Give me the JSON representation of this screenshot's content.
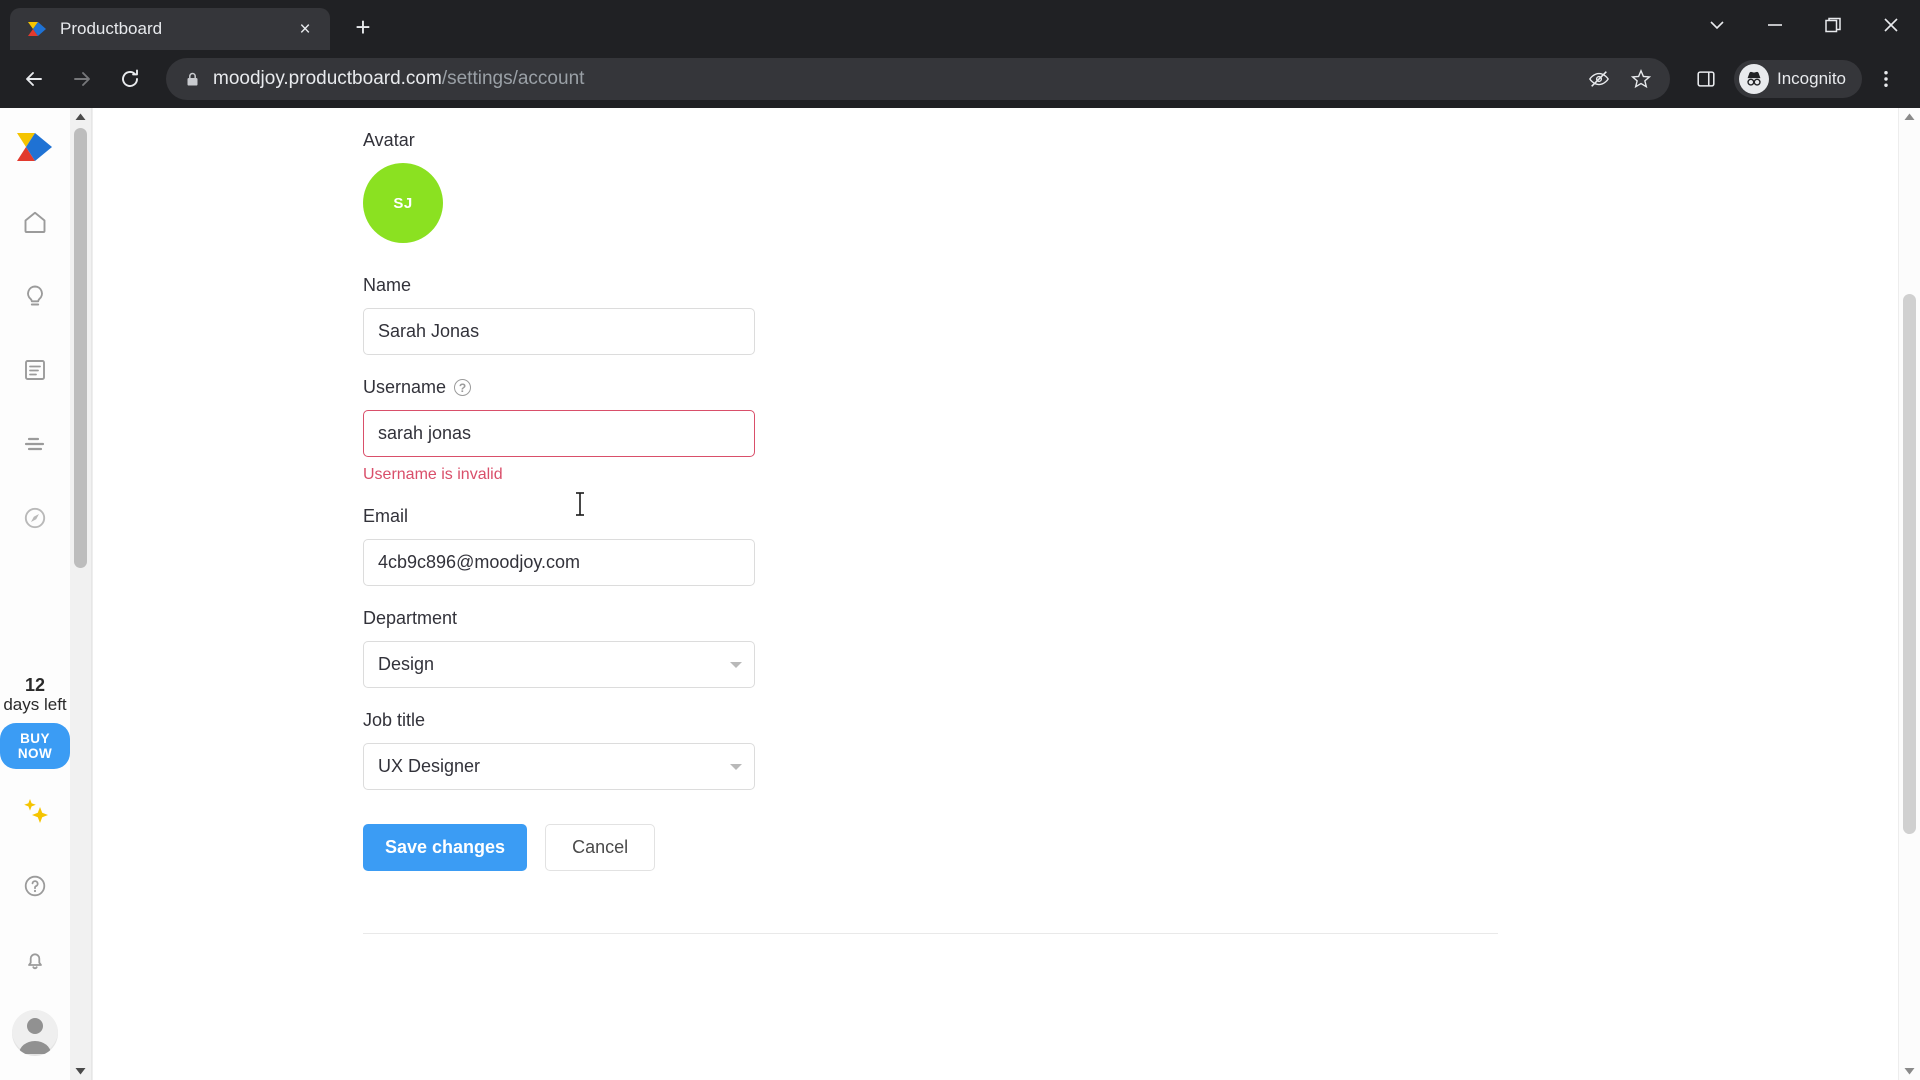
{
  "browser": {
    "tab": {
      "title": "Productboard",
      "favicon": "productboard-logo-icon",
      "close_label": "×"
    },
    "new_tab_label": "+",
    "window_controls": {
      "minimize": "−",
      "restore": "❐",
      "close": "✕",
      "tab_search": "∨"
    },
    "nav": {
      "back": "←",
      "forward": "→",
      "reload": "↻"
    },
    "address": {
      "lock_icon": "lock-icon",
      "host": "moodjoy.productboard.com",
      "path": "/settings/account",
      "full_url": "moodjoy.productboard.com/settings/account"
    },
    "omnibox_icons": {
      "tracking_protection": "eye-off-icon",
      "bookmark": "star-icon"
    },
    "toolbar_icons": {
      "side_panel": "side-panel-icon",
      "menu": "three-dot-menu-icon"
    },
    "profile": {
      "label": "Incognito",
      "icon": "incognito-hat-icon"
    }
  },
  "rail": {
    "logo": "productboard-logo-icon",
    "items": [
      {
        "name": "home",
        "icon": "home-icon"
      },
      {
        "name": "insights",
        "icon": "lightbulb-icon"
      },
      {
        "name": "features",
        "icon": "document-icon"
      },
      {
        "name": "roadmap",
        "icon": "list-lines-icon"
      },
      {
        "name": "portal",
        "icon": "compass-icon"
      }
    ],
    "trial": {
      "days": "12",
      "label": "days left",
      "cta": "BUY NOW"
    },
    "sparkle_icon": "sparkles-icon",
    "bottom_items": [
      {
        "name": "help",
        "icon": "question-circle-icon"
      },
      {
        "name": "notifications",
        "icon": "bell-icon"
      },
      {
        "name": "account",
        "icon": "user-avatar-icon"
      }
    ]
  },
  "form": {
    "avatar": {
      "label": "Avatar",
      "initials": "SJ",
      "color": "#8be121"
    },
    "name": {
      "label": "Name",
      "value": "Sarah Jonas"
    },
    "username": {
      "label": "Username",
      "help_icon": "question-circle-icon",
      "value": "sarah jonas",
      "error": "Username is invalid",
      "error_color": "#d94f6a",
      "invalid": true
    },
    "email": {
      "label": "Email",
      "value": "4cb9c896@moodjoy.com"
    },
    "department": {
      "label": "Department",
      "value": "Design"
    },
    "job_title": {
      "label": "Job title",
      "value": "UX Designer"
    },
    "actions": {
      "save": "Save changes",
      "cancel": "Cancel",
      "save_color": "#3b9cf4"
    }
  }
}
